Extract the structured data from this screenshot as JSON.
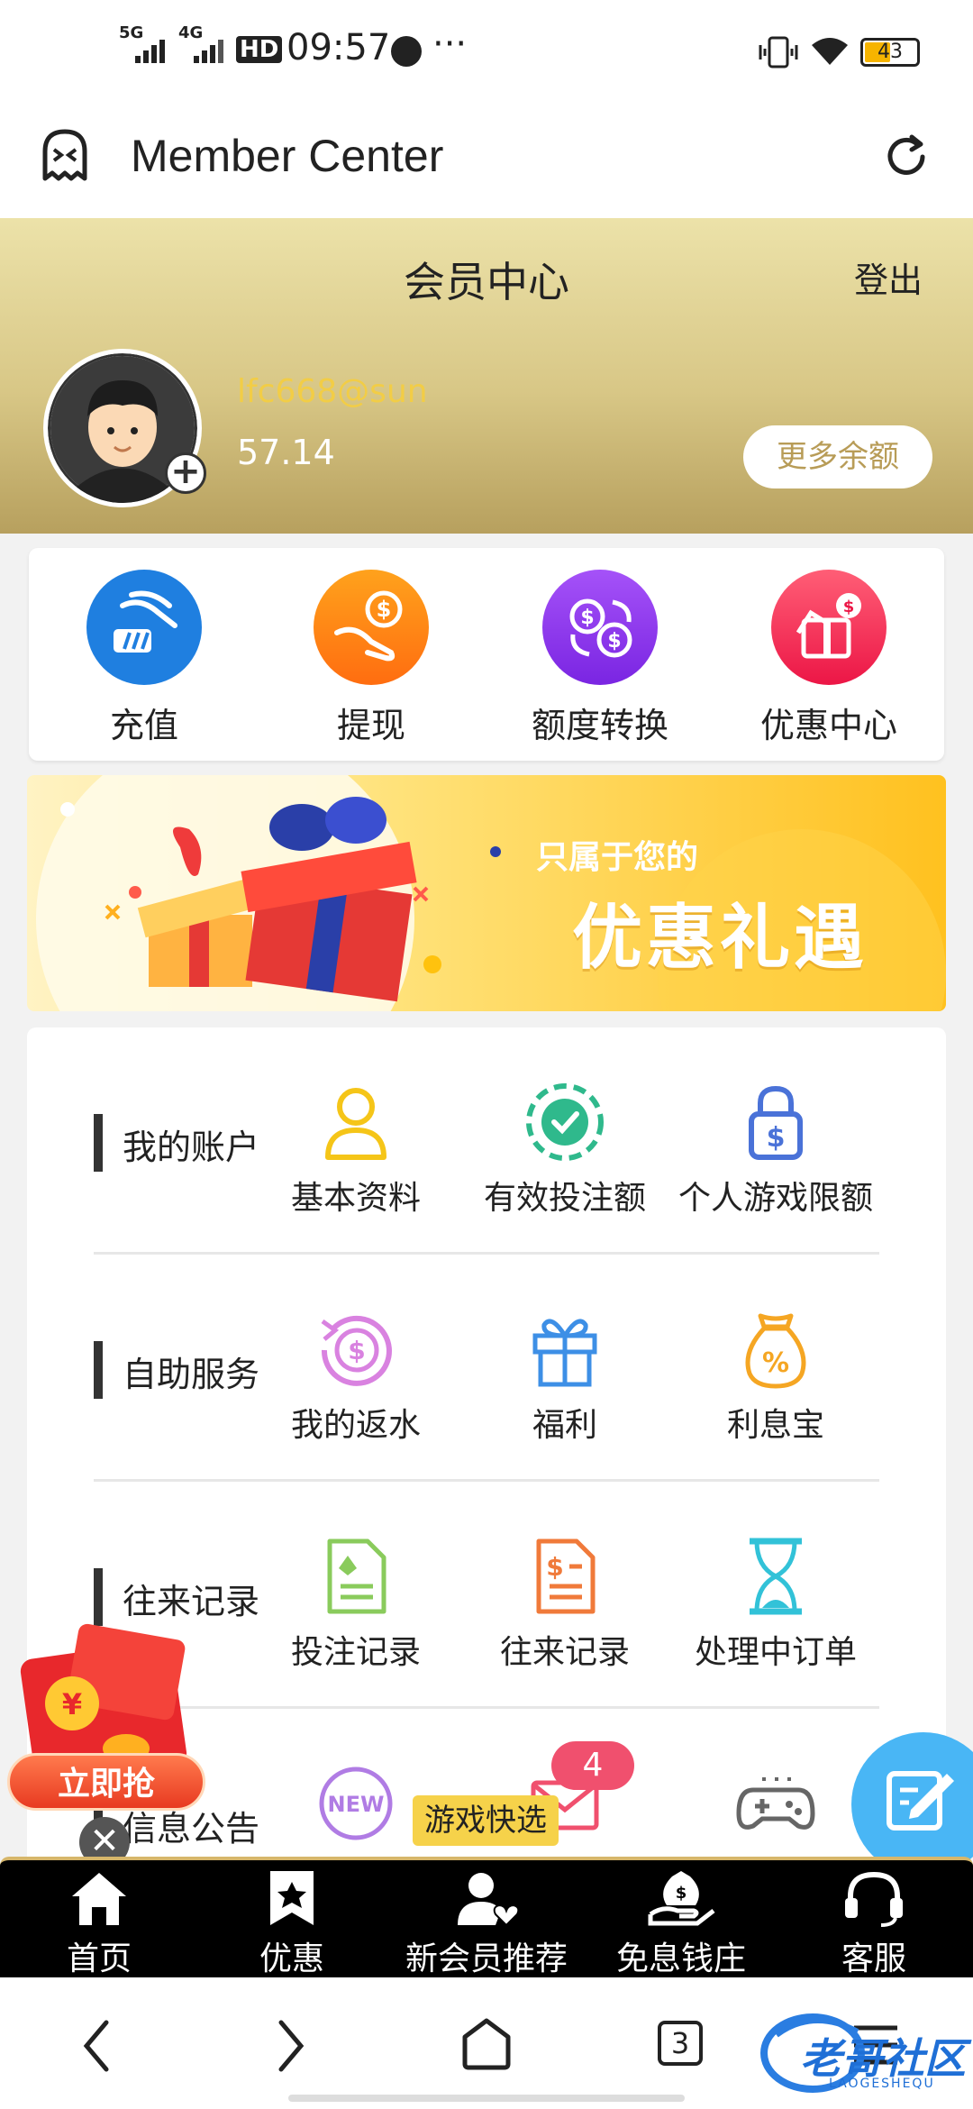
{
  "status_bar": {
    "network_1": "5G",
    "network_2": "4G",
    "hd": "HD",
    "time": "09:57",
    "more": "···",
    "battery": "43"
  },
  "app_bar": {
    "title": "Member Center"
  },
  "hero": {
    "title": "会员中心",
    "logout": "登出",
    "username": "lfc668@sun",
    "balance": "57.14",
    "more_balance": "更多余额"
  },
  "quick_actions": [
    {
      "label": "充值",
      "icon": "recharge-icon",
      "color": "#1f7fe0"
    },
    {
      "label": "提现",
      "icon": "withdraw-icon",
      "color": "#ff7d12"
    },
    {
      "label": "额度转换",
      "icon": "transfer-icon",
      "color": "#8a3cf0"
    },
    {
      "label": "优惠中心",
      "icon": "promo-icon",
      "color": "#f02c5a"
    }
  ],
  "banner": {
    "line1": "只属于您的",
    "line2": "优惠礼遇"
  },
  "sections": [
    {
      "name": "我的账户",
      "items": [
        {
          "label": "基本资料",
          "icon": "user-icon"
        },
        {
          "label": "有效投注额",
          "icon": "chip-icon"
        },
        {
          "label": "个人游戏限额",
          "icon": "lock-dollar-icon"
        }
      ]
    },
    {
      "name": "自助服务",
      "items": [
        {
          "label": "我的返水",
          "icon": "rebate-icon"
        },
        {
          "label": "福利",
          "icon": "gift-icon"
        },
        {
          "label": "利息宝",
          "icon": "money-bag-icon"
        }
      ]
    },
    {
      "name": "往来记录",
      "items": [
        {
          "label": "投注记录",
          "icon": "bet-record-icon"
        },
        {
          "label": "往来记录",
          "icon": "transaction-record-icon"
        },
        {
          "label": "处理中订单",
          "icon": "hourglass-icon"
        }
      ]
    },
    {
      "name": "信息公告",
      "items": [
        {
          "label": "",
          "icon": "new-icon"
        },
        {
          "label": "",
          "icon": "mail-icon",
          "badge": "4"
        },
        {
          "label": "",
          "icon": "gamepad-icon"
        }
      ]
    }
  ],
  "floaters": {
    "grab_now": "立即抢",
    "close": "✕",
    "game_quick": "游戏快选"
  },
  "bottom_nav": [
    {
      "label": "首页",
      "icon": "home-icon"
    },
    {
      "label": "优惠",
      "icon": "star-bookmark-icon"
    },
    {
      "label": "新会员推荐",
      "icon": "member-heart-icon"
    },
    {
      "label": "免息钱庄",
      "icon": "money-hand-icon"
    },
    {
      "label": "客服",
      "icon": "headset-icon"
    }
  ],
  "system_nav": {
    "tab_count": "3",
    "watermark": "老哥社区",
    "watermark_sub": "LAOGESHEQU"
  }
}
